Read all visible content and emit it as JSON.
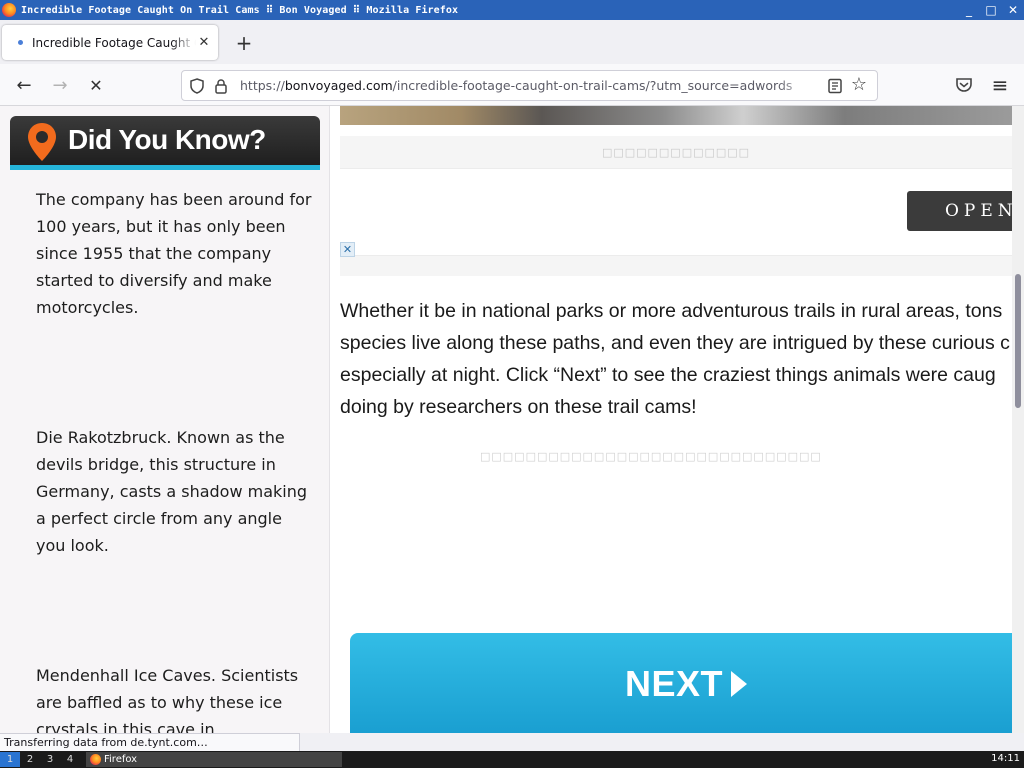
{
  "window": {
    "title": "Incredible Footage Caught On Trail Cams ⠿ Bon Voyaged ⠿ Mozilla Firefox",
    "controls": {
      "minimize": "_",
      "maximize": "□",
      "close": "✕"
    }
  },
  "tabs": [
    {
      "title": "Incredible Footage Caught On Trail Cams",
      "close": "✕"
    }
  ],
  "newtab_label": "+",
  "nav": {
    "back": "←",
    "forward": "→",
    "stop": "✕",
    "url_prefix": "https://",
    "url_host": "bonvoyaged.com",
    "url_path": "/incredible-footage-caught-on-trail-cams/?utm_source=adwords",
    "star": "☆",
    "pocket": "pocket-icon",
    "menu": "≡"
  },
  "sidebar": {
    "heading": "Did You Know?",
    "facts": [
      "The company has been around for 100 years, but it has only been since 1955 that the company started to diversify and make motorcycles.",
      "Die Rakotzbruck.  Known as the devils bridge, this structure in Germany, casts a shadow making a perfect circle from any angle you look.",
      "Mendenhall Ice Caves.  Scientists are baffled as to why these ice crystals in this cave in"
    ]
  },
  "main": {
    "ad_label": "□□□□□□□□□□□□□",
    "ad_button": "OPEN",
    "ad_close": "✕",
    "article_lines": [
      "Whether it be in national parks or more adventurous trails in rural areas, tons",
      "species live along these paths, and even they are intrigued by these curious c",
      "especially at night. Click “Next” to see the craziest things animals were caug",
      "doing by researchers on these trail cams!"
    ],
    "boxes_label": "□□□□□□□□□□□□□□□□□□□□□□□□□□□□□□",
    "next_label": "NEXT"
  },
  "status_text": "Transferring data from de.tynt.com…",
  "taskbar": {
    "workspaces": [
      "1",
      "2",
      "3",
      "4"
    ],
    "task_label": "Firefox",
    "clock": "14:11"
  },
  "colors": {
    "titlebar": "#2a63b8",
    "accent_blue": "#25b4d9",
    "next_button": "#1a9fd1",
    "pin_orange": "#f26b1d"
  }
}
